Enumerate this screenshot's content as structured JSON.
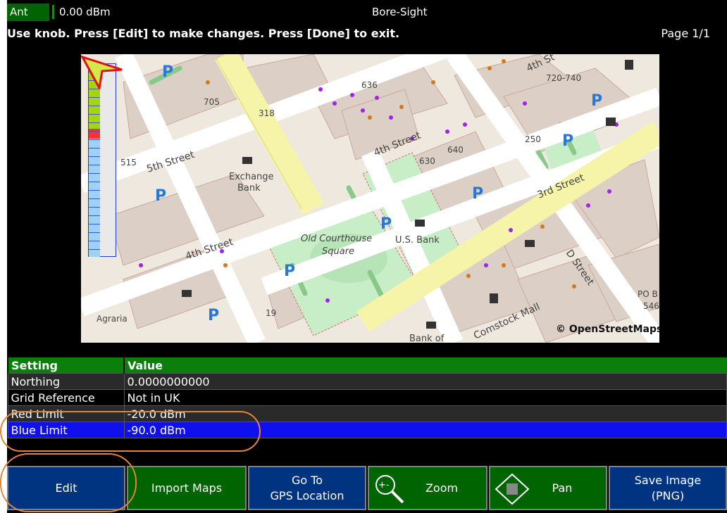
{
  "header": {
    "ant_label": "Ant",
    "power": "0.00 dBm",
    "mode": "Bore-Sight",
    "instruction": "Use knob. Press [Edit] to make changes. Press [Done] to exit.",
    "page": "Page 1/1"
  },
  "map": {
    "labels": {
      "street_5th": "5th Street",
      "street_4th_upper": "4th Street",
      "street_4th_lower": "4th Street",
      "street_4th_topright": "4th St",
      "street_3rd": "3rd Street",
      "street_d": "D Street",
      "mall": "Comstock Mall",
      "exchange_bank_1": "Exchange",
      "exchange_bank_2": "Bank",
      "us_bank": "U.S. Bank",
      "bank_of": "Bank of",
      "courthouse_1": "Old Courthouse",
      "courthouse_2": "Square",
      "agraria": "Agraria",
      "po_box": "PO B",
      "n546": "546",
      "n705": "705",
      "n318": "318",
      "n636": "636",
      "n640": "640",
      "n630": "630",
      "n250": "250",
      "n720": "720-740",
      "n515": "515",
      "n19": "19",
      "copyright": "© OpenStreetMaps"
    }
  },
  "table": {
    "headers": [
      "Setting",
      "Value"
    ],
    "rows": [
      {
        "setting": "Northing",
        "value": "0.0000000000"
      },
      {
        "setting": "Grid Reference",
        "value": "Not in UK"
      },
      {
        "setting": "Red Limit",
        "value": "-20.0 dBm"
      },
      {
        "setting": "Blue Limit",
        "value": "-90.0 dBm"
      }
    ]
  },
  "softkeys": {
    "edit": "Edit",
    "import_maps": "Import Maps",
    "goto_1": "Go To",
    "goto_2": "GPS Location",
    "zoom": "Zoom",
    "pan": "Pan",
    "save_1": "Save Image",
    "save_2": "(PNG)"
  },
  "colors": {
    "header_green": "#006400",
    "softkey_blue": "#003380",
    "selected_row": "#1010ee",
    "callout": "#e8833a"
  }
}
